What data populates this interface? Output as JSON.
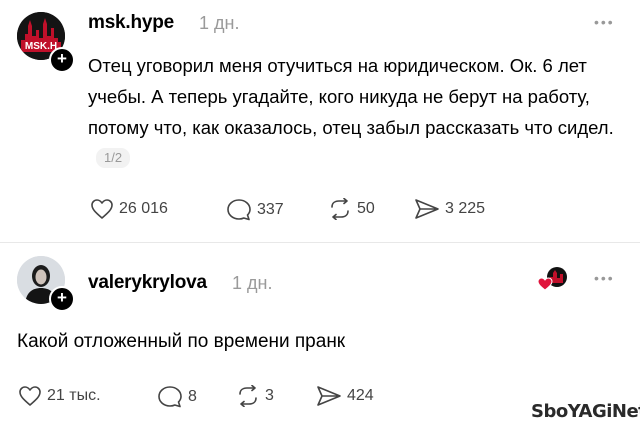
{
  "post": {
    "username": "msk.hype",
    "time": "1 дн.",
    "avatar_text": "MSK.H",
    "text": "Отец уговорил меня отучиться на юридическом. Ок. 6 лет учебы. А теперь угадайте, кого никуда не берут на работу, потому что, как оказалось, отец забыл рассказать что сидел.",
    "pager": "1/2",
    "likes": "26 016",
    "comments": "337",
    "reposts": "50",
    "shares": "3 225"
  },
  "reply": {
    "username": "valerykrylova",
    "time": "1 дн.",
    "text": "Какой отложенный по времени пранк",
    "likes": "21 тыс.",
    "comments": "8",
    "reposts": "3",
    "shares": "424"
  },
  "menu_dots": "•••",
  "follow_plus": "+",
  "watermark": "SboYAGiNet",
  "icons": {
    "like": "heart-icon",
    "comment": "comment-bubble-icon",
    "repost": "repost-arrows-icon",
    "share": "send-icon"
  },
  "colors": {
    "secondary_text": "#9a9a9a",
    "accent_red": "#e0143c"
  }
}
